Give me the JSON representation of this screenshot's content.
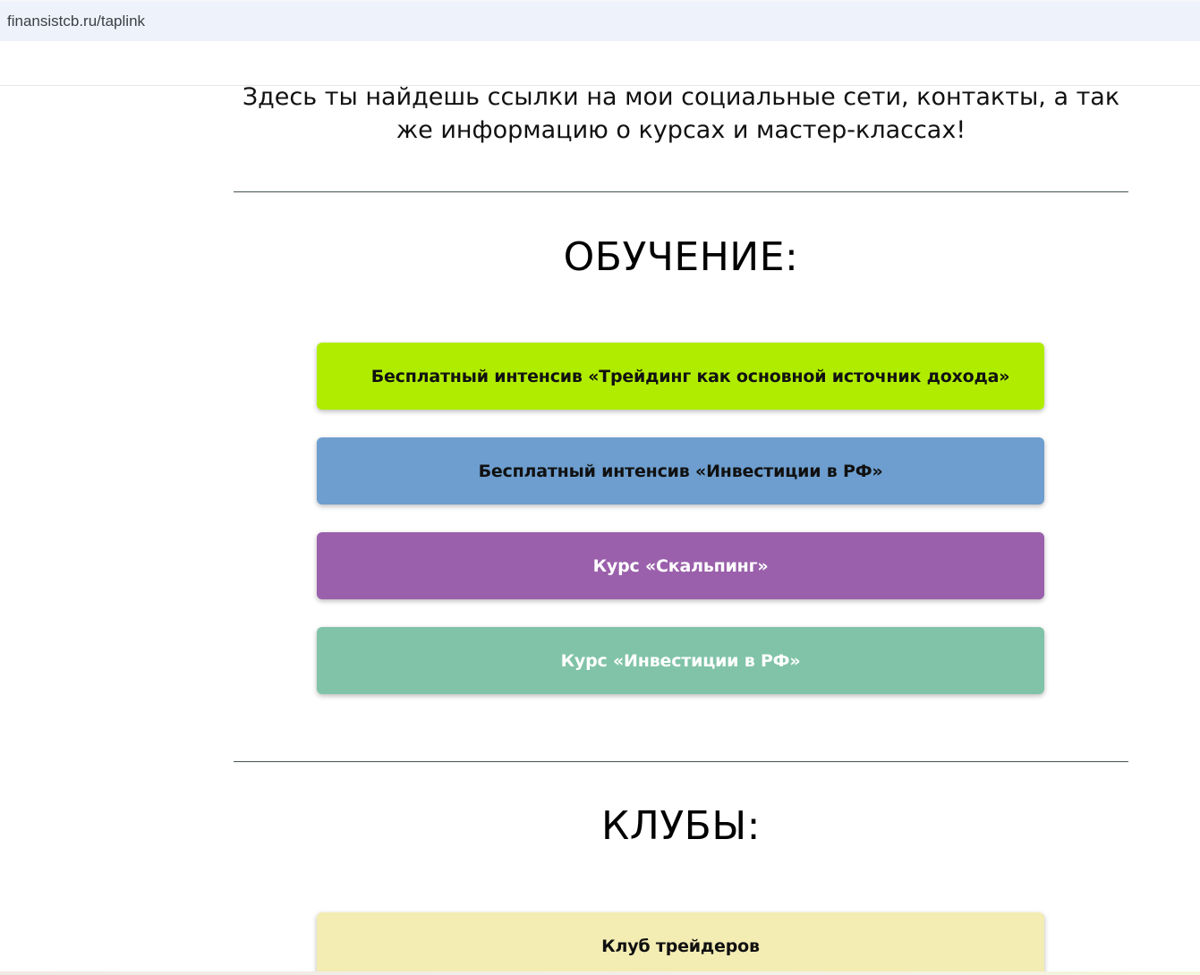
{
  "browser": {
    "url": "finansistcb.ru/taplink"
  },
  "intro": {
    "text": "Здесь ты найдешь ссылки на мои социальные сети, контакты, а так же информацию о курсах и мастер-классах!"
  },
  "learning": {
    "title": "ОБУЧЕНИЕ:",
    "buttons": [
      {
        "label": "Бесплатный интенсив «Трейдинг как основной источник дохода»",
        "color": "#b0ec00"
      },
      {
        "label": "Бесплатный интенсив «Инвестиции в РФ»",
        "color": "#6d9ecf"
      },
      {
        "label": "Курс «Скальпинг»",
        "color": "#9a60ab"
      },
      {
        "label": "Курс «Инвестиции в РФ»",
        "color": "#80c3a8"
      }
    ]
  },
  "clubs": {
    "title": "КЛУБЫ:",
    "buttons": [
      {
        "label": "Клуб трейдеров",
        "color": "#f3ecb3"
      }
    ]
  }
}
